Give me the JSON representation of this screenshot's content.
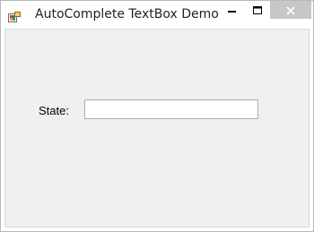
{
  "window": {
    "title": "AutoComplete TextBox Demo",
    "controls": {
      "minimize_icon": "minimize-icon",
      "maximize_icon": "maximize-icon",
      "close_icon": "close-icon"
    },
    "colors": {
      "close_button_bg": "#c7c7c7",
      "client_bg": "#f0f0f0"
    }
  },
  "form": {
    "state_label": "State:",
    "state_value": "",
    "state_placeholder": ""
  }
}
